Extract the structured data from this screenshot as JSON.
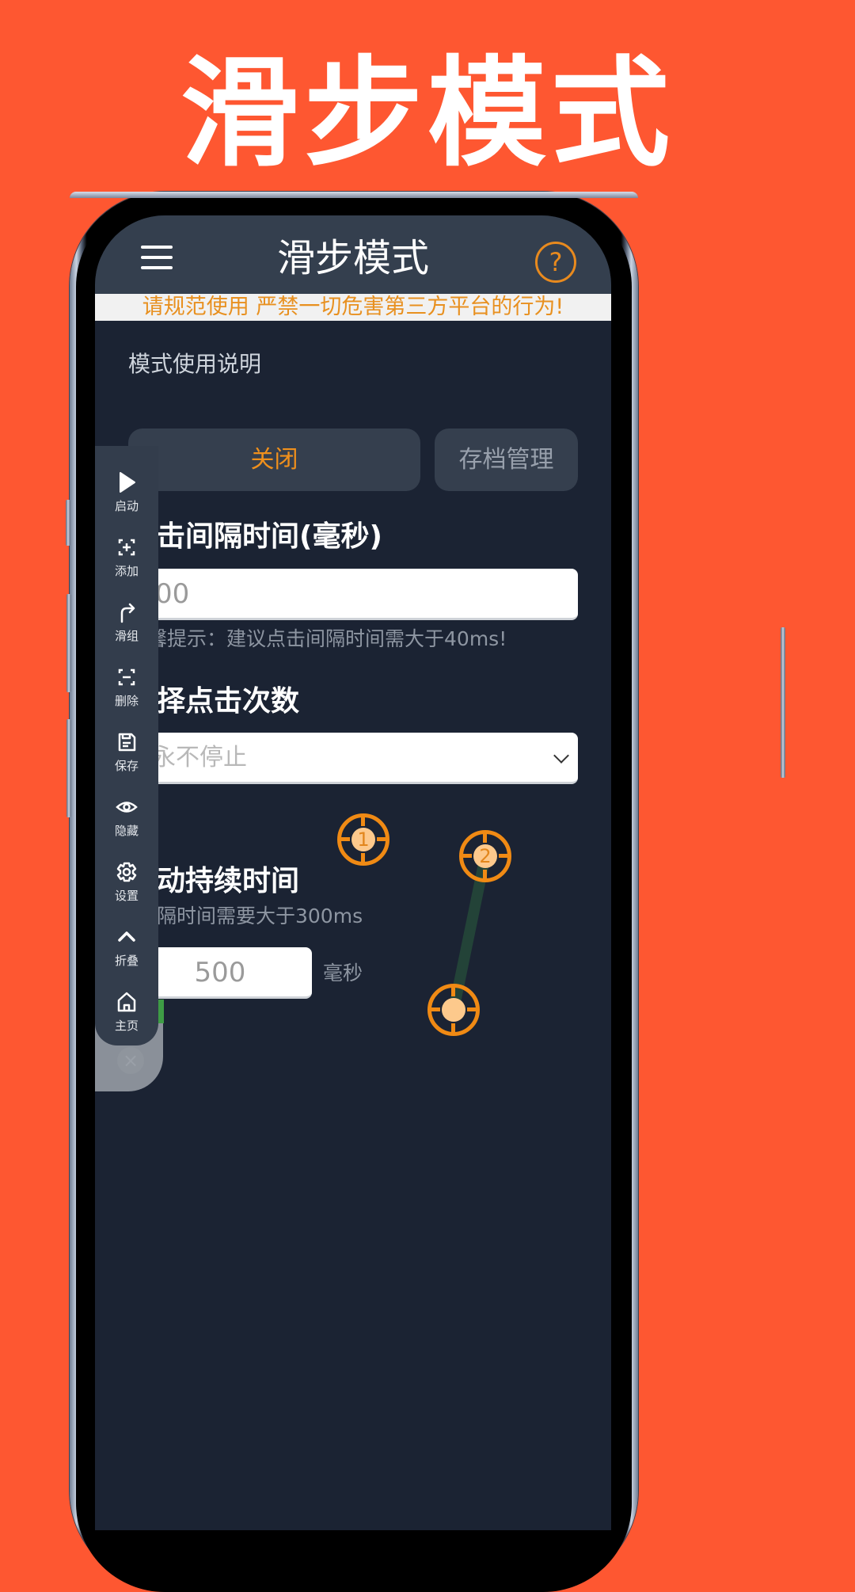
{
  "promo": {
    "title": "滑步模式",
    "background_color": "#FE5731"
  },
  "app": {
    "header": {
      "title": "滑步模式",
      "menu_icon": "hamburger-menu-icon",
      "help_icon": "question-circle-icon",
      "help_glyph": "?"
    },
    "warning_banner": "请规范使用 严禁一切危害第三方平台的行为!",
    "mode_instructions_link": "模式使用说明",
    "buttons": {
      "close": "关闭",
      "archive_management": "存档管理"
    },
    "click_interval": {
      "heading": "击间隔时间(毫秒)",
      "value": "00",
      "hint": "馨提示：建议点击间隔时间需大于40ms!"
    },
    "click_count": {
      "heading": "择点击次数",
      "selected": "永不停止"
    },
    "slide_duration": {
      "heading": "动持续时间",
      "hint": "隔时间需要大于300ms",
      "value": "500",
      "unit": "毫秒"
    },
    "targets": [
      {
        "label": "1"
      },
      {
        "label": "2"
      },
      {
        "label": ""
      }
    ],
    "floating_toolbar": {
      "items": [
        {
          "label": "启动",
          "icon": "play-icon"
        },
        {
          "label": "添加",
          "icon": "add-target-icon"
        },
        {
          "label": "滑组",
          "icon": "turn-right-arrow-icon"
        },
        {
          "label": "删除",
          "icon": "remove-target-icon"
        },
        {
          "label": "保存",
          "icon": "save-icon"
        },
        {
          "label": "隐藏",
          "icon": "eye-icon"
        },
        {
          "label": "设置",
          "icon": "gear-icon"
        },
        {
          "label": "折叠",
          "icon": "chevron-up-icon"
        },
        {
          "label": "主页",
          "icon": "home-icon"
        }
      ],
      "dismiss_glyph": "×"
    },
    "colors": {
      "accent_orange": "#F08A14",
      "header_bg": "#343F4E",
      "main_bg": "#1B2333",
      "path_line": "#234338"
    }
  }
}
